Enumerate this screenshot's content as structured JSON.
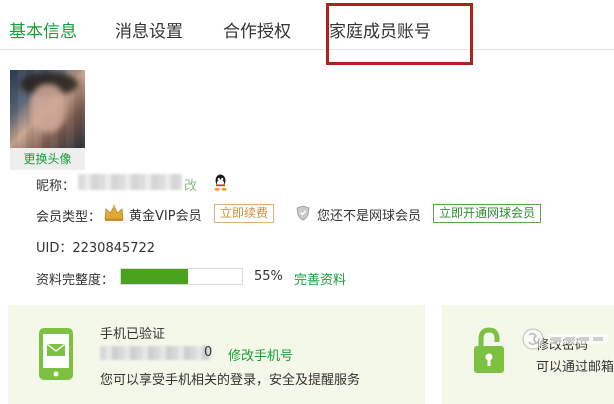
{
  "tabs": [
    {
      "label": "基本信息",
      "active": true
    },
    {
      "label": "消息设置",
      "active": false
    },
    {
      "label": "合作授权",
      "active": false
    },
    {
      "label": "家庭成员账号",
      "active": false
    }
  ],
  "avatar": {
    "change_label": "更换头像"
  },
  "profile": {
    "nickname_label": "昵称：",
    "nickname_edit": "改",
    "member_type_label": "会员类型：",
    "vip_text": "黄金VIP会员",
    "renew_button": "立即续费",
    "not_member_text": "您还不是网球会员",
    "open_button": "立即开通网球会员",
    "uid_text": "UID：2230845722",
    "completeness_label": "资料完整度：",
    "completeness_percent": "55%",
    "completeness_value": 0.55,
    "complete_link": "完善资料"
  },
  "cards": {
    "phone": {
      "title": "手机已验证",
      "phone_suffix": "0",
      "change_link": "修改手机号",
      "desc": "您可以享受手机相关的登录，安全及提醒服务"
    },
    "password": {
      "title": "修改密码",
      "desc": "可以通过邮箱"
    }
  },
  "colors": {
    "accent_green": "#1a9c3a",
    "progress_green": "#49a21b",
    "highlight_red": "#b0201f",
    "card_bg": "#f4f8e9",
    "renew_orange": "#d28c3a"
  },
  "icons": [
    "qq-icon",
    "crown-icon",
    "shield-icon",
    "phone-icon",
    "lock-icon",
    "watermark-icon"
  ]
}
